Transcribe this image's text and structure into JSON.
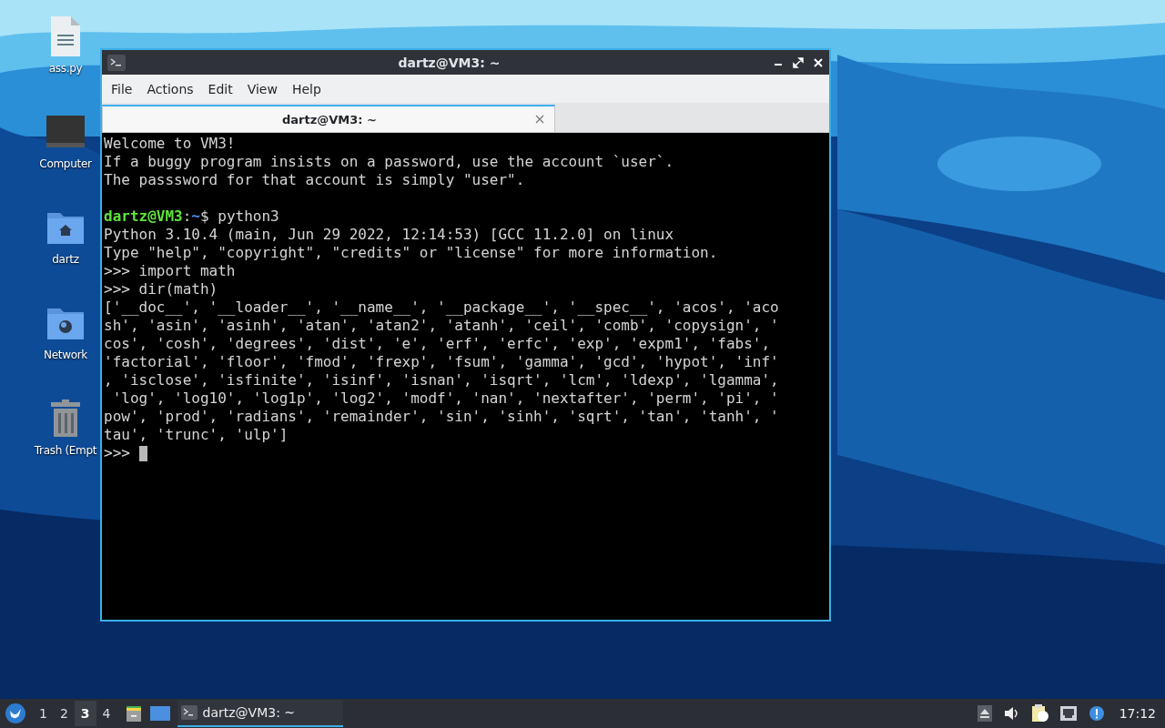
{
  "desktop": {
    "icons": [
      {
        "kind": "document",
        "label": "ass.py"
      },
      {
        "kind": "computer",
        "label": "Computer"
      },
      {
        "kind": "home",
        "label": "dartz"
      },
      {
        "kind": "network",
        "label": "Network"
      },
      {
        "kind": "trash",
        "label": "Trash (Empt"
      }
    ]
  },
  "window": {
    "title": "dartz@VM3: ~",
    "menu": [
      "File",
      "Actions",
      "Edit",
      "View",
      "Help"
    ],
    "tabs": [
      {
        "label": "dartz@VM3: ~",
        "selected": true
      }
    ],
    "terminal": {
      "lines": [
        {
          "kind": "text",
          "text": "Welcome to VM3!"
        },
        {
          "kind": "text",
          "text": "If a buggy program insists on a password, use the account `user`."
        },
        {
          "kind": "text",
          "text": "The passsword for that account is simply \"user\"."
        },
        {
          "kind": "blank"
        },
        {
          "kind": "prompt",
          "user_host": "dartz@VM3",
          "separator": ":",
          "path": "~",
          "command": "$ python3"
        },
        {
          "kind": "text",
          "text": "Python 3.10.4 (main, Jun 29 2022, 12:14:53) [GCC 11.2.0] on linux"
        },
        {
          "kind": "text",
          "text": "Type \"help\", \"copyright\", \"credits\" or \"license\" for more information."
        },
        {
          "kind": "text",
          "text": ">>> import math"
        },
        {
          "kind": "text",
          "text": ">>> dir(math)"
        },
        {
          "kind": "text",
          "text": "['__doc__', '__loader__', '__name__', '__package__', '__spec__', 'acos', 'aco"
        },
        {
          "kind": "text",
          "text": "sh', 'asin', 'asinh', 'atan', 'atan2', 'atanh', 'ceil', 'comb', 'copysign', '"
        },
        {
          "kind": "text",
          "text": "cos', 'cosh', 'degrees', 'dist', 'e', 'erf', 'erfc', 'exp', 'expm1', 'fabs',"
        },
        {
          "kind": "text",
          "text": "'factorial', 'floor', 'fmod', 'frexp', 'fsum', 'gamma', 'gcd', 'hypot', 'inf'"
        },
        {
          "kind": "text",
          "text": ", 'isclose', 'isfinite', 'isinf', 'isnan', 'isqrt', 'lcm', 'ldexp', 'lgamma',"
        },
        {
          "kind": "text",
          "text": " 'log', 'log10', 'log1p', 'log2', 'modf', 'nan', 'nextafter', 'perm', 'pi', '"
        },
        {
          "kind": "text",
          "text": "pow', 'prod', 'radians', 'remainder', 'sin', 'sinh', 'sqrt', 'tan', 'tanh', '"
        },
        {
          "kind": "text",
          "text": "tau', 'trunc', 'ulp']"
        },
        {
          "kind": "input",
          "text": ">>>"
        }
      ]
    }
  },
  "taskbar": {
    "workspaces": [
      {
        "label": "1",
        "selected": false
      },
      {
        "label": "2",
        "selected": false
      },
      {
        "label": "3",
        "selected": true
      },
      {
        "label": "4",
        "selected": false
      }
    ],
    "tasks": [
      {
        "label": "dartz@VM3: ~",
        "selected": true
      }
    ],
    "clock": "17:12"
  }
}
